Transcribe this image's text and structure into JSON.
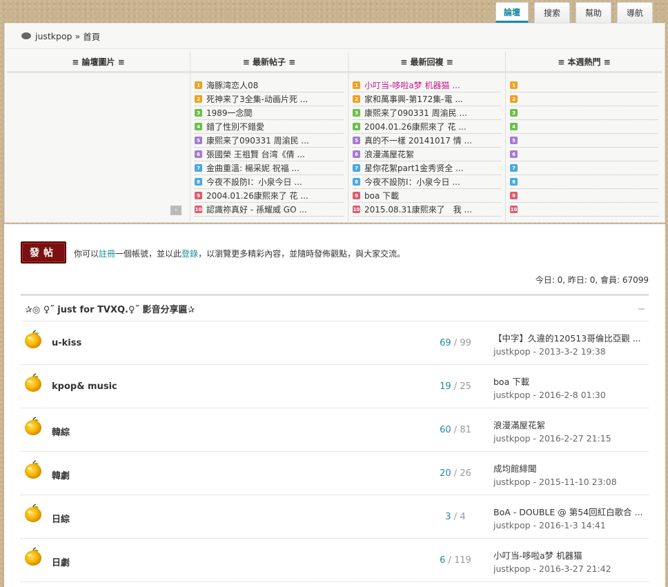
{
  "tabs": {
    "forum": "論壇",
    "search": "搜索",
    "help": "幫助",
    "nav": "導航"
  },
  "breadcrumb": {
    "site": "justkpop",
    "sep": "»",
    "home": "首頁"
  },
  "columns": {
    "images": "≡ 論壇圖片 ≡",
    "newest": "≡ 最新帖子 ≡",
    "replies": "≡ 最新回複 ≡",
    "hot": "≡ 本週熱門 ≡"
  },
  "newest_posts": [
    "海豚湾恋人08",
    "死神来了3全集-动画片死 ...",
    "1989一念間",
    "錯了性別不錯愛",
    "康熙来了090331 周渝民 ...",
    "張國榮 王祖賢 台湾《倩 ...",
    "金曲重溫: 楊采妮 祝福 ...",
    "今夜不設防I：小泉今日 ...",
    "2004.01.26康熙來了 花 ...",
    "認識祢真好 - 孫耀威 GO ..."
  ],
  "latest_replies": [
    "小叮当-哆啦a梦 机器猫 ...",
    "家和萬事興-第172集-電 ...",
    "康熙来了090331 周渝民 ...",
    "2004.01.26康熙來了 花 ...",
    "真的不一樣 20141017 情 ...",
    "浪漫滿屋花絮",
    "星你花絮part1金秀贤全 ...",
    "今夜不設防I：小泉今日 ...",
    "boa 下載",
    "2015.08.31康熙來了　我 ..."
  ],
  "rank_numbers": [
    "1",
    "2",
    "3",
    "4",
    "5",
    "6",
    "7",
    "8",
    "9",
    "10"
  ],
  "pager_icon": "›",
  "post_button": "發帖",
  "notice": {
    "pre": "你可以",
    "register": "註冊",
    "mid": "一個帳號，並以此",
    "login": "登錄",
    "post": "，以瀏覽更多精彩內容，並隨時發佈觀點，與大家交流。"
  },
  "stats": "今日: 0, 昨日: 0, 會員: 67099",
  "section_title": "✰◎ ♀˝ just for TVXQ.♀˝ 影音分享匾✰",
  "forums": [
    {
      "name": "u-kiss",
      "threads": "69",
      "posts": "99",
      "last_title": "【中字】久違的120513哥倫比亞觀 ...",
      "last_by": "justkpop - 2013-3-2 19:38"
    },
    {
      "name": "kpop& music",
      "threads": "19",
      "posts": "25",
      "last_title": "boa 下載",
      "last_by": "justkpop - 2016-2-8 01:30"
    },
    {
      "name": "韓綜",
      "threads": "60",
      "posts": "81",
      "last_title": "浪漫滿屋花絮",
      "last_by": "justkpop - 2016-2-27 21:15"
    },
    {
      "name": "韓劇",
      "threads": "20",
      "posts": "26",
      "last_title": "成均館緋聞",
      "last_by": "justkpop - 2015-11-10 23:08"
    },
    {
      "name": "日綜",
      "threads": "3",
      "posts": "4",
      "last_title": "BoA - DOUBLE @ 第54回紅白歌合 ...",
      "last_by": "justkpop - 2016-1-3 14:41"
    },
    {
      "name": "日劇",
      "threads": "6",
      "posts": "119",
      "last_title": "小叮当-哆啦a梦 机器猫",
      "last_by": "justkpop - 2016-3-27 21:42"
    }
  ],
  "count_sep": "/"
}
